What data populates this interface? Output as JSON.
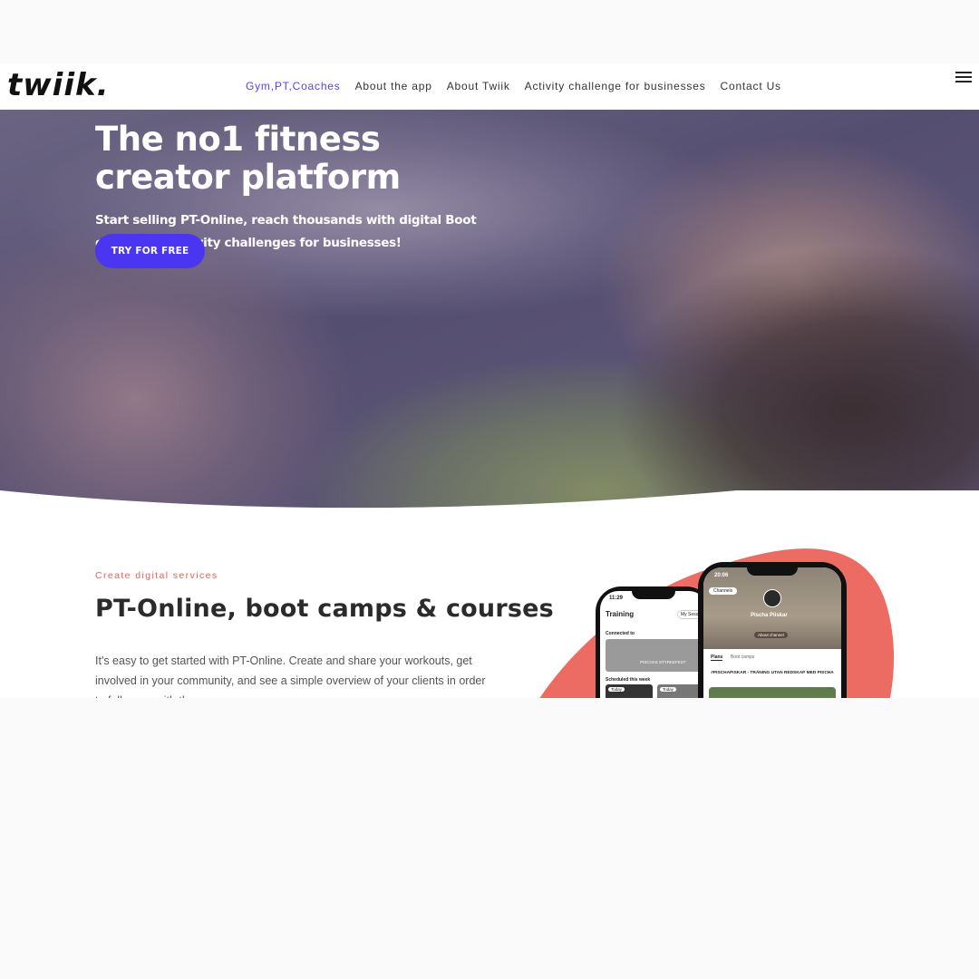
{
  "brand": {
    "logo": "twiik."
  },
  "nav": {
    "items": [
      {
        "label": "Gym,PT,Coaches",
        "active": true
      },
      {
        "label": "About the app"
      },
      {
        "label": "About Twiik"
      },
      {
        "label": "Activity challenge for businesses"
      },
      {
        "label": "Contact Us"
      }
    ]
  },
  "hero": {
    "title": "The no1 fitness creator platform",
    "subtitle": "Start selling PT-Online, reach thousands with digital Boot camps and activity challenges for businesses!",
    "cta": "TRY FOR FREE"
  },
  "section": {
    "eyebrow": "Create digital services",
    "title": "PT-Online, boot camps & courses",
    "body": "It's easy to get started with PT-Online. Create and share your workouts, get involved in your community, and see a simple overview of your clients in order to follow up with them."
  },
  "phone_left": {
    "time": "11:29",
    "header": "Training",
    "tab": "My Sessions",
    "connected_label": "Connected to",
    "card_label": "PISCHAS STYRKEFEST",
    "scheduled_label": "Scheduled this week",
    "badge1": "Today",
    "badge2": "Today"
  },
  "phone_right": {
    "time": "20:06",
    "channels": "Channels",
    "profile_name": "Pischa Piiskar",
    "about_button": "About channel",
    "tab_plans": "Plans",
    "tab_bootcamps": "Boot camps",
    "plan_title": "#PISCHAPISKAR - TRÄNING UTAN REDSKAP MED PISCHA"
  },
  "colors": {
    "accent": "#5b3ff2",
    "cta": "#4a35f0",
    "coral": "#ec6b63",
    "eyebrow": "#e8625a"
  }
}
